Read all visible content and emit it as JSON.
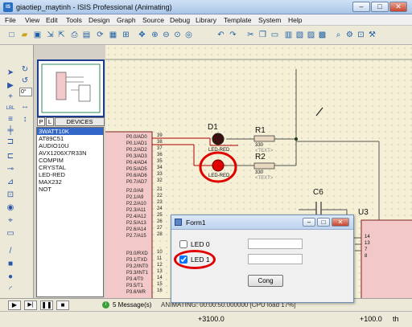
{
  "window": {
    "title": "giaotiep_maytinh - ISIS Professional (Animating)",
    "controls": [
      "–",
      "□",
      "✕"
    ]
  },
  "menu": [
    "File",
    "View",
    "Edit",
    "Tools",
    "Design",
    "Graph",
    "Source",
    "Debug",
    "Library",
    "Template",
    "System",
    "Help"
  ],
  "rotation_field": "0°",
  "selector_tabs": [
    "P",
    "L"
  ],
  "devices_label": "DEVICES",
  "devices": [
    "3WATT10K",
    "AT89C51",
    "AUDIO10U",
    "AVX1206X7R33N",
    "COMPIM",
    "CRYSTAL",
    "LED-RED",
    "MAX232",
    "NOT"
  ],
  "selected_device_index": 0,
  "schematic": {
    "pins_right": [
      {
        "num": "39",
        "name": "P0.0/AD0"
      },
      {
        "num": "38",
        "name": "P0.1/AD1"
      },
      {
        "num": "37",
        "name": "P0.2/AD2"
      },
      {
        "num": "36",
        "name": "P0.3/AD3"
      },
      {
        "num": "35",
        "name": "P0.4/AD4"
      },
      {
        "num": "34",
        "name": "P0.5/AD5"
      },
      {
        "num": "33",
        "name": "P0.6/AD6"
      },
      {
        "num": "32",
        "name": "P0.7/AD7"
      },
      {
        "num": "21",
        "name": "P2.0/A8"
      },
      {
        "num": "22",
        "name": "P2.1/A9"
      },
      {
        "num": "23",
        "name": "P2.2/A10"
      },
      {
        "num": "24",
        "name": "P2.3/A11"
      },
      {
        "num": "25",
        "name": "P2.4/A12"
      },
      {
        "num": "26",
        "name": "P2.5/A13"
      },
      {
        "num": "27",
        "name": "P2.6/A14"
      },
      {
        "num": "28",
        "name": "P2.7/A15"
      },
      {
        "num": "10",
        "name": "P3.0/RXD"
      },
      {
        "num": "11",
        "name": "P3.1/TXD"
      },
      {
        "num": "12",
        "name": "P3.2/INT0"
      },
      {
        "num": "13",
        "name": "P3.3/INT1"
      },
      {
        "num": "14",
        "name": "P3.4/T0"
      },
      {
        "num": "15",
        "name": "P3.5/T1"
      },
      {
        "num": "16",
        "name": "P3.6/WR"
      }
    ],
    "d1": {
      "ref": "D1",
      "value": "LED-RED"
    },
    "d2": {
      "ref": "",
      "value": "LED-RED"
    },
    "r1": {
      "ref": "R1",
      "value": "330",
      "text": "<TEXT>"
    },
    "r2": {
      "ref": "R2",
      "value": "330",
      "text": "<TEXT>"
    },
    "c6": "C6",
    "u3": "U3",
    "right_pins": [
      "14",
      "13",
      "7",
      "8"
    ]
  },
  "form": {
    "title": "Form1",
    "led0_label": "LED 0",
    "led0_checked": false,
    "led1_label": "LED 1",
    "led1_checked": true,
    "led0_text": "",
    "led1_text": "",
    "button_label": "Cong",
    "controls": [
      "–",
      "□",
      "✕"
    ]
  },
  "status": {
    "messages": "5 Message(s)",
    "animating": "ANIMATING: 00:00:50.000000 [CPU load 17%]",
    "coord_x": "+3100.0",
    "coord_y": "+100.0",
    "unit": "th"
  },
  "colors": {
    "led_on": "#e00000",
    "highlight_circle": "#e00000",
    "wire_red": "#b00000",
    "chip_fill": "#f2c8c8"
  }
}
